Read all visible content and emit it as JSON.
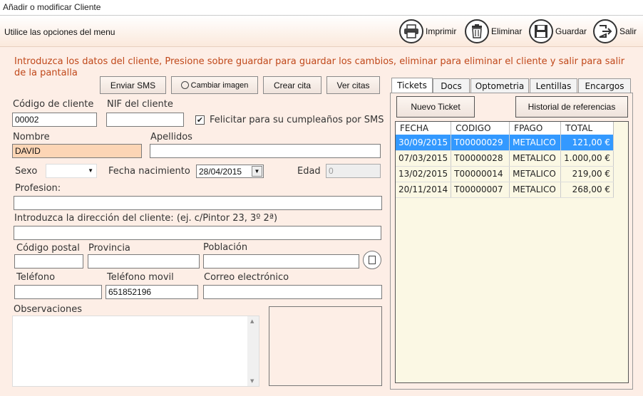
{
  "window": {
    "title": "Añadir o modificar Cliente"
  },
  "toolbar": {
    "hint": "Utilice las opciones del menu",
    "print": "Imprimir",
    "delete": "Eliminar",
    "save": "Guardar",
    "exit": "Salir"
  },
  "info": "Introduzca los datos del cliente, Presione sobre guardar para guardar los cambios, eliminar para eliminar el cliente y salir para salir de la pantalla",
  "actions": {
    "sms": "Enviar SMS",
    "image": "Cambiar imagen",
    "appointment": "Crear cita",
    "view_appointments": "Ver citas"
  },
  "form": {
    "code_label": "Código de cliente",
    "code_value": "00002",
    "nif_label": "NIF del cliente",
    "nif_value": "",
    "birthday_sms_label": "Felicitar para su cumpleaños por SMS",
    "birthday_sms_checked": true,
    "name_label": "Nombre",
    "name_value": "DAVID",
    "surname_label": "Apellidos",
    "surname_value": "",
    "sex_label": "Sexo",
    "sex_value": "",
    "birth_label": "Fecha nacimiento",
    "birth_value": "28/04/2015",
    "age_label": "Edad",
    "age_value": "0",
    "profession_label": "Profesion:",
    "profession_value": "",
    "address_label": "Introduzca la dirección del cliente: (ej. c/Pintor 23, 3º 2ª)",
    "address_value": "",
    "zip_label": "Código postal",
    "province_label": "Provincia",
    "city_label": "Población",
    "phone_label": "Teléfono",
    "mobile_label": "Teléfono movil",
    "mobile_value": "651852196",
    "email_label": "Correo electrónico",
    "notes_label": "Observaciones"
  },
  "tabs": [
    "Tickets",
    "Docs",
    "Optometria",
    "Lentillas",
    "Encargos"
  ],
  "tickets": {
    "new_label": "Nuevo Ticket",
    "history_label": "Historial de referencias",
    "columns": [
      "FECHA",
      "CODIGO",
      "FPAGO",
      "TOTAL"
    ],
    "rows": [
      [
        "30/09/2015",
        "T00000029",
        "METALICO",
        "121,00 €"
      ],
      [
        "07/03/2015",
        "T00000028",
        "METALICO",
        "1.000,00 €"
      ],
      [
        "13/02/2015",
        "T00000014",
        "METALICO",
        "219,00 €"
      ],
      [
        "20/11/2014",
        "T00000007",
        "METALICO",
        "268,00 €"
      ]
    ],
    "selected_row": 0
  },
  "colors": {
    "accent": "#3399ff",
    "background": "#fdeee6",
    "info_text": "#c0481a"
  }
}
